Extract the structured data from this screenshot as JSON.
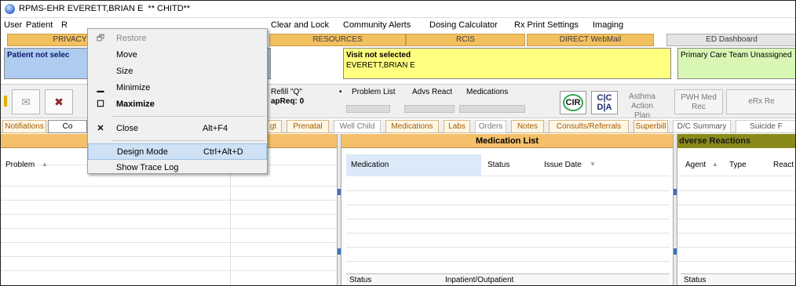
{
  "window": {
    "title": "RPMS-EHR EVERETT,BRIAN E  ** CHITD**",
    "icon": "app-globe-icon"
  },
  "menubar": {
    "items_left": [
      "User",
      "Patient",
      "R"
    ],
    "items_right": [
      "Clear and Lock",
      "Community Alerts",
      "Dosing Calculator",
      "Rx Print Settings",
      "Imaging"
    ]
  },
  "top_tabs": {
    "privacy": "PRIVACY",
    "resources": "RESOURCES",
    "rcis": "RCIS",
    "direct": "DIRECT WebMail",
    "ed_dashboard": "ED Dashboard"
  },
  "info": {
    "patient": "Patient not selec",
    "visit_line1": "Visit not selected",
    "visit_line2": "EVERETT,BRIAN E",
    "care_team": "Primary Care Team Unassigned"
  },
  "toolbar": {
    "refill_line1": "Refill \"Q\"",
    "refill_line2": "apReq: 0",
    "bullet": "•",
    "problem_list": "Problem List",
    "advs_react": "Advs React",
    "medications": "Medications",
    "cir": "CIR",
    "cic_top": "C|C",
    "cic_bottom": "D|A",
    "asthma_line1": "Asthma Action",
    "asthma_line2": "Plan",
    "pwh_line1": "PWH Med",
    "pwh_line2": "Rec",
    "erx": "eRx Re"
  },
  "tabs2": [
    "Notifiations",
    "Co",
    "gt",
    "Prenatal",
    "Well Child",
    "Medications",
    "Labs",
    "Orders",
    "Notes",
    "Consults/Referrals",
    "Superbill",
    "D/C Summary",
    "Suicide F"
  ],
  "panels": {
    "problem_col": "Problem",
    "sort_asc": "▲",
    "sort_desc": "▼",
    "med_header": "Medication List",
    "med_cols": [
      "Medication",
      "Status",
      "Issue Date"
    ],
    "med_footer_status": "Status",
    "med_footer_io": "Inpatient/Outpatient",
    "adverse_header": "dverse Reactions",
    "adverse_cols": [
      "Agent",
      "Type",
      "React"
    ],
    "adverse_footer_status": "Status"
  },
  "context_menu": {
    "items": [
      {
        "icon": "restore-icon",
        "glyph": "🗗",
        "label": "Restore",
        "shortcut": "",
        "disabled": true
      },
      {
        "icon": "",
        "glyph": "",
        "label": "Move",
        "shortcut": "",
        "disabled": false
      },
      {
        "icon": "",
        "glyph": "",
        "label": "Size",
        "shortcut": "",
        "disabled": false
      },
      {
        "icon": "minimize-icon",
        "glyph": "▁",
        "label": "Minimize",
        "shortcut": "",
        "disabled": false
      },
      {
        "icon": "maximize-icon",
        "glyph": "☐",
        "label": "Maximize",
        "shortcut": "",
        "disabled": false
      },
      {
        "icon": "close-icon",
        "glyph": "✕",
        "label": "Close",
        "shortcut": "Alt+F4",
        "disabled": false
      },
      {
        "icon": "",
        "glyph": "",
        "label": "Design Mode",
        "shortcut": "Ctrl+Alt+D",
        "disabled": false
      },
      {
        "icon": "",
        "glyph": "",
        "label": "Show Trace Log",
        "shortcut": "",
        "disabled": false
      }
    ]
  },
  "colors": {
    "tab_orange": "#f3c060",
    "patient_panel": "#aecbf0",
    "visit_panel": "#ffff80",
    "care_team_panel": "#d9f7b4",
    "adverse_header_bg": "#8a8a1a",
    "menu_highlight": "#cfe2f5"
  }
}
